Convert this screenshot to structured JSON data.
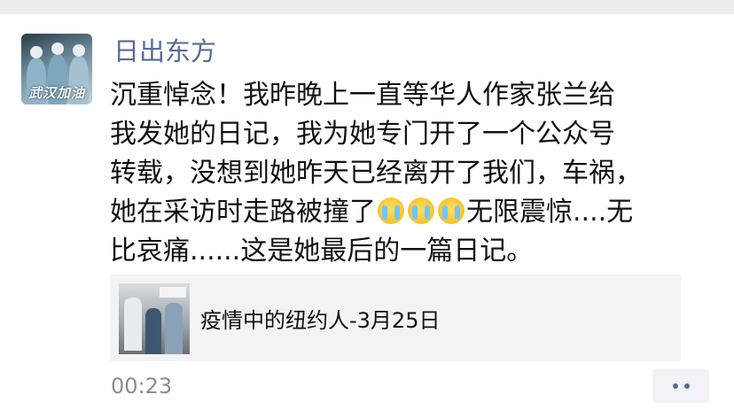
{
  "post": {
    "author_name": "日出东方",
    "avatar_caption": "武汉加油",
    "text_lines": [
      "沉重悼念！我昨晚上一直等华人作家张兰给",
      "我发她的日记，我为她专门开了一个公众号",
      "转载，没想到她昨天已经离开了我们，车祸，",
      "她在采访时走路被撞了",
      "无限震惊....无",
      "比哀痛......这是她最后的一篇日记。"
    ],
    "emoji": [
      "crying-face-icon",
      "crying-face-icon",
      "crying-face-icon"
    ],
    "shared_article": {
      "title": "疫情中的纽约人-3月25日"
    },
    "timestamp": "00:23",
    "colors": {
      "name_link": "#576b95",
      "text": "#111111",
      "timestamp": "#8c8c8c",
      "card_bg": "#f3f3f5"
    }
  }
}
